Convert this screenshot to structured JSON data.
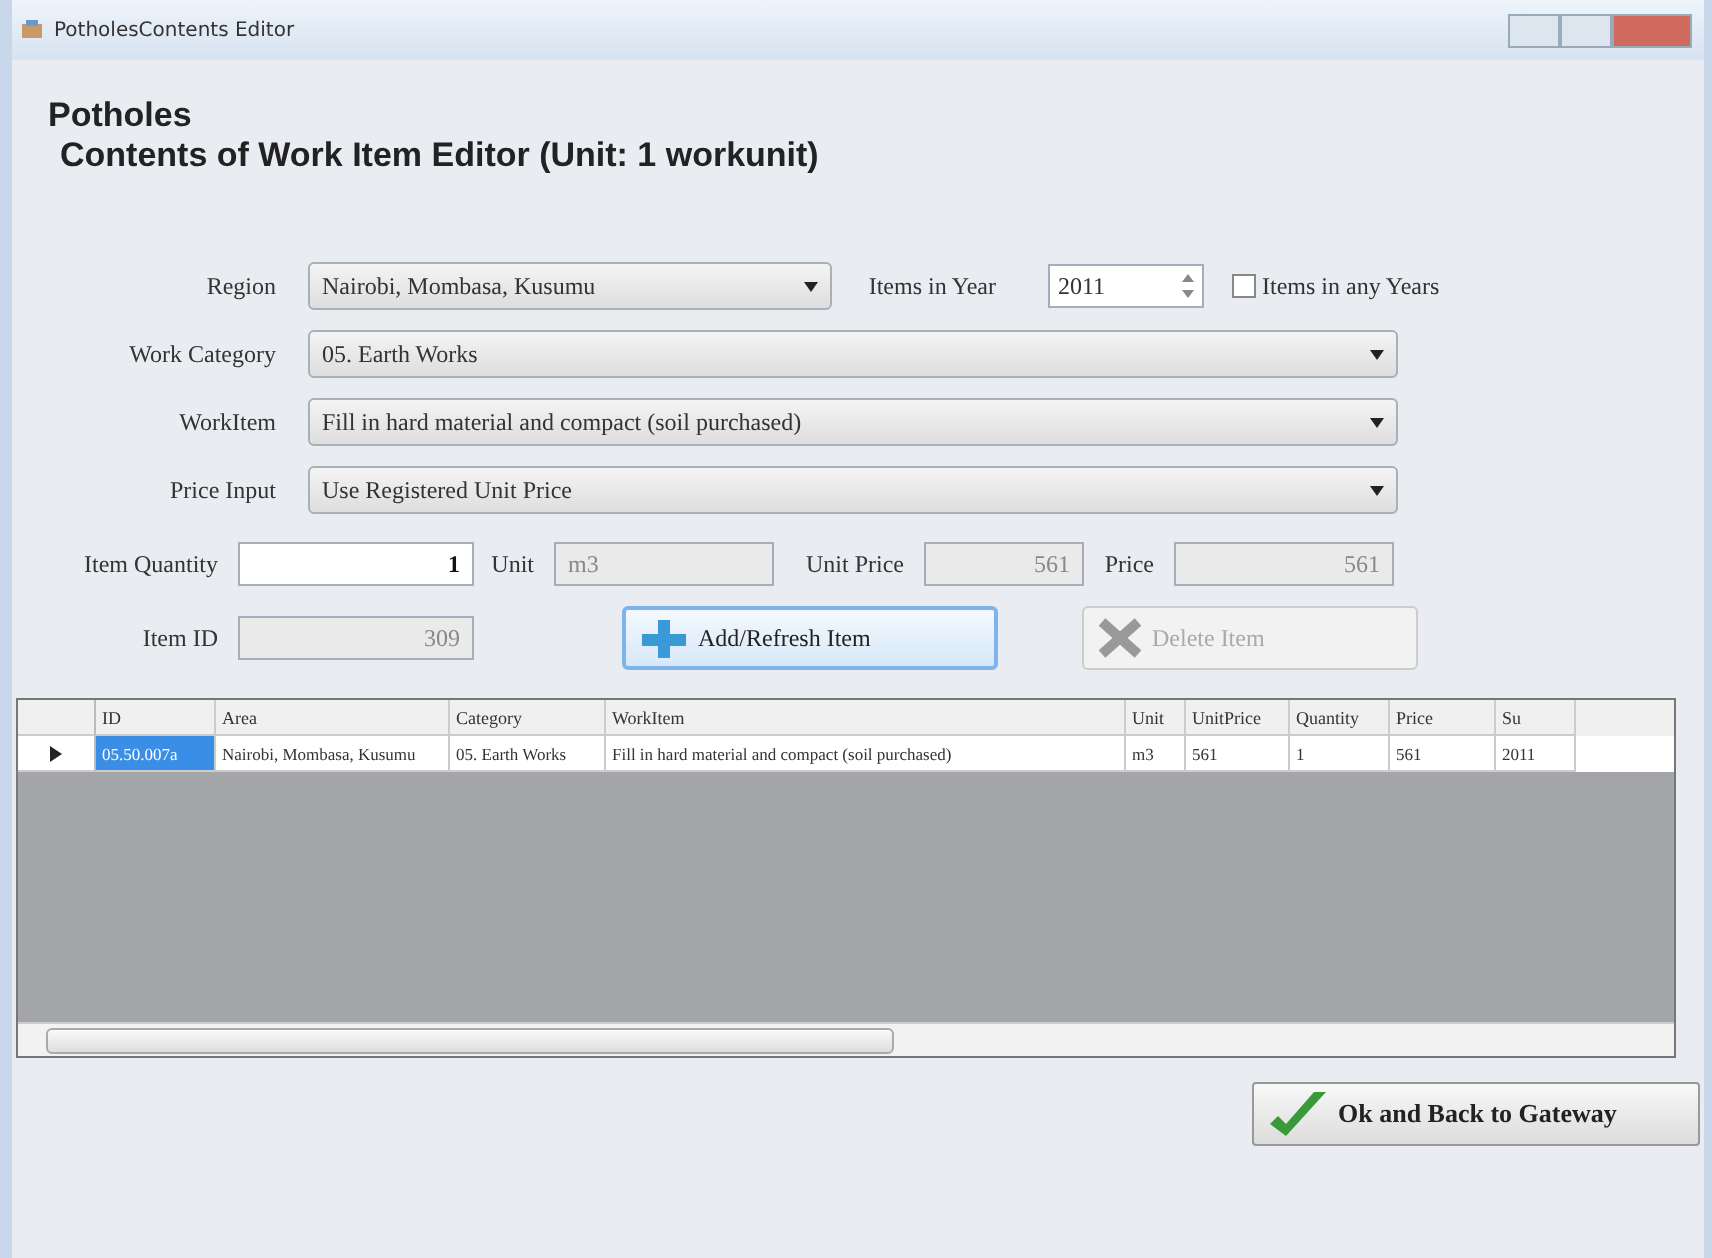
{
  "window": {
    "title": "PotholesContents Editor"
  },
  "heading": {
    "line_1": "Potholes",
    "line_2": "Contents of Work Item Editor (Unit: 1 workunit)"
  },
  "region": {
    "label": "Region",
    "value": "Nairobi, Mombasa, Kusumu"
  },
  "year": {
    "label": "Items in Year",
    "value": "2011"
  },
  "any_years": {
    "label": "Items in any Years",
    "checked": false
  },
  "combos": [
    {
      "label": "Work Category",
      "value": "05. Earth Works"
    },
    {
      "label": "WorkItem",
      "value": "Fill in hard material and compact (soil purchased)"
    },
    {
      "label": "Price Input",
      "value": "Use Registered Unit Price"
    }
  ],
  "row_1": [
    {
      "label": "Item Quantity",
      "value": "1",
      "disabled": false
    },
    {
      "label": "Unit",
      "value": "m3",
      "disabled": true
    },
    {
      "label": "Unit Price",
      "value": "561",
      "disabled": true
    },
    {
      "label": "Price",
      "value": "561",
      "disabled": true
    }
  ],
  "item_id": {
    "label": "Item ID",
    "value": "309",
    "disabled": true
  },
  "buttons": [
    {
      "label": "Add/Refresh Item",
      "kind": "add",
      "disabled": false
    },
    {
      "label": "Delete Item",
      "kind": "delete",
      "disabled": true
    }
  ],
  "table": {
    "columns": [
      "ID",
      "Area",
      "Category",
      "WorkItem",
      "Unit",
      "UnitPrice",
      "Quantity",
      "Price",
      "Su"
    ],
    "rows": [
      {
        "current": true,
        "cells": [
          {
            "text": "05.50.007a",
            "selected": true
          },
          {
            "text": "Nairobi, Mombasa, Kusumu",
            "selected": false
          },
          {
            "text": "05. Earth Works",
            "selected": false
          },
          {
            "text": "Fill in hard material and compact (soil purchased)",
            "selected": false
          },
          {
            "text": "m3",
            "selected": false
          },
          {
            "text": "561",
            "selected": false
          },
          {
            "text": "1",
            "selected": false
          },
          {
            "text": "561",
            "selected": false
          },
          {
            "text": "2011",
            "selected": false
          }
        ]
      }
    ]
  },
  "ok_button": {
    "label": "Ok and Back to Gateway"
  }
}
